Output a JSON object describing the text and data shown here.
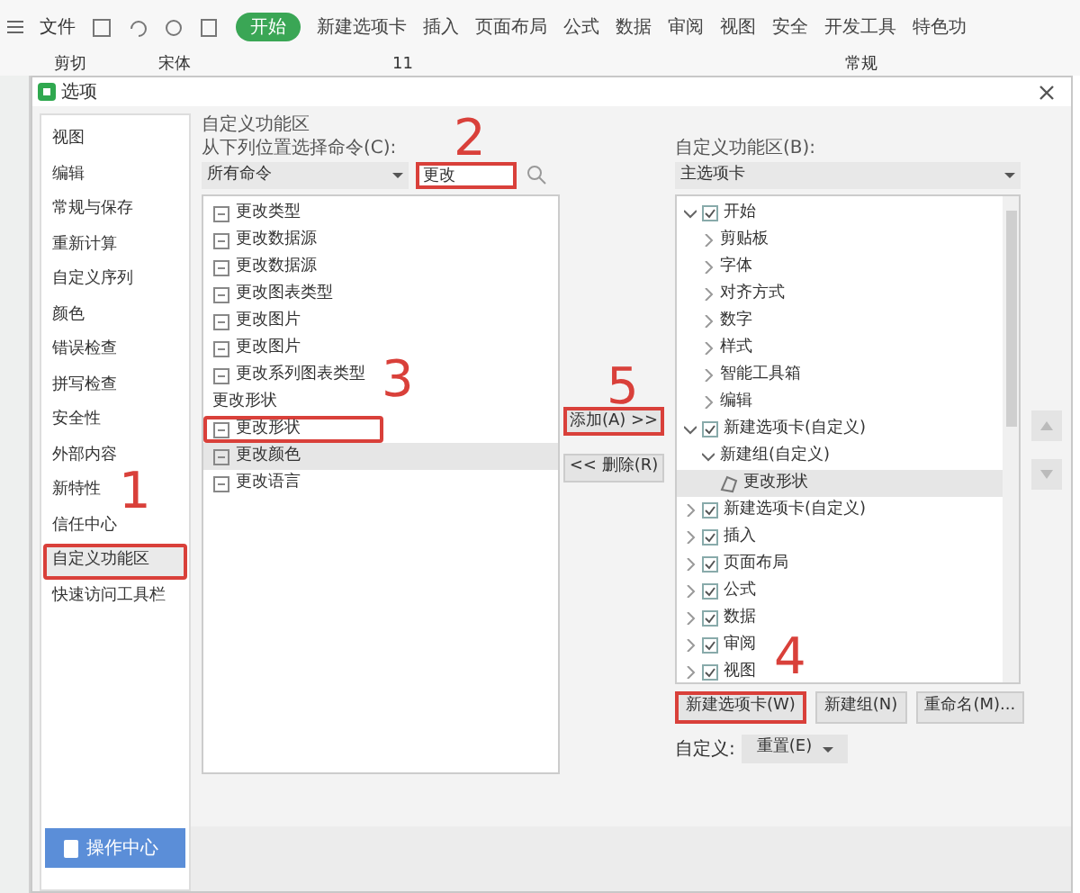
{
  "ribbon": {
    "file_menu": "文件",
    "tabs": [
      {
        "label": "开始",
        "selected": true
      },
      {
        "label": "新建选项卡",
        "selected": false
      },
      {
        "label": "插入",
        "selected": false
      },
      {
        "label": "页面布局",
        "selected": false
      },
      {
        "label": "公式",
        "selected": false
      },
      {
        "label": "数据",
        "selected": false
      },
      {
        "label": "审阅",
        "selected": false
      },
      {
        "label": "视图",
        "selected": false
      },
      {
        "label": "安全",
        "selected": false
      },
      {
        "label": "开发工具",
        "selected": false
      },
      {
        "label": "特色功",
        "selected": false
      }
    ]
  },
  "toolbar": {
    "cut": "剪切",
    "font": "宋体",
    "font_size": "11",
    "number_format": "常规"
  },
  "dialog": {
    "title": "选项",
    "sidebar": {
      "items": [
        {
          "label": "视图",
          "selected": false,
          "boxed": false
        },
        {
          "label": "编辑",
          "selected": false,
          "boxed": false
        },
        {
          "label": "常规与保存",
          "selected": false,
          "boxed": false
        },
        {
          "label": "重新计算",
          "selected": false,
          "boxed": false
        },
        {
          "label": "自定义序列",
          "selected": false,
          "boxed": false
        },
        {
          "label": "颜色",
          "selected": false,
          "boxed": false
        },
        {
          "label": "错误检查",
          "selected": false,
          "boxed": false
        },
        {
          "label": "拼写检查",
          "selected": false,
          "boxed": false
        },
        {
          "label": "安全性",
          "selected": false,
          "boxed": false
        },
        {
          "label": "外部内容",
          "selected": false,
          "boxed": false
        },
        {
          "label": "新特性",
          "selected": false,
          "boxed": false
        },
        {
          "label": "信任中心",
          "selected": false,
          "boxed": false
        },
        {
          "label": "自定义功能区",
          "selected": true,
          "boxed": true
        },
        {
          "label": "快速访问工具栏",
          "selected": false,
          "boxed": false
        }
      ],
      "action_button": "操作中心"
    },
    "left_panel": {
      "group_label": "自定义功能区",
      "source_label": "从下列位置选择命令(C):",
      "source_dropdown": "所有命令",
      "search": {
        "value": "更改",
        "boxed": true
      },
      "commands": [
        {
          "label": "更改类型",
          "kind": "command",
          "selected": false,
          "boxed": false
        },
        {
          "label": "更改数据源",
          "kind": "command",
          "selected": false,
          "boxed": false
        },
        {
          "label": "更改数据源",
          "kind": "command",
          "selected": false,
          "boxed": false
        },
        {
          "label": "更改图表类型",
          "kind": "command",
          "selected": false,
          "boxed": false
        },
        {
          "label": "更改图片",
          "kind": "command",
          "selected": false,
          "boxed": false
        },
        {
          "label": "更改图片",
          "kind": "command",
          "selected": false,
          "boxed": false
        },
        {
          "label": "更改系列图表类型",
          "kind": "command",
          "selected": false,
          "boxed": false
        },
        {
          "label": "更改形状",
          "kind": "heading",
          "selected": false,
          "boxed": false
        },
        {
          "label": "更改形状",
          "kind": "command",
          "selected": false,
          "boxed": true
        },
        {
          "label": "更改颜色",
          "kind": "command",
          "selected": true,
          "boxed": false
        },
        {
          "label": "更改语言",
          "kind": "command",
          "selected": false,
          "boxed": false
        }
      ]
    },
    "add_button": {
      "label": "添加(A) >>",
      "boxed": true
    },
    "remove_button": {
      "label": "<< 删除(R)",
      "boxed": false
    },
    "right_panel": {
      "label": "自定义功能区(B):",
      "dropdown": "主选项卡",
      "tree": [
        {
          "label": "开始",
          "kind": "tab",
          "checked": true,
          "expanded": true,
          "selected": false,
          "children": [
            {
              "label": "剪贴板",
              "kind": "group",
              "expanded": false,
              "selected": false
            },
            {
              "label": "字体",
              "kind": "group",
              "expanded": false,
              "selected": false
            },
            {
              "label": "对齐方式",
              "kind": "group",
              "expanded": false,
              "selected": false
            },
            {
              "label": "数字",
              "kind": "group",
              "expanded": false,
              "selected": false
            },
            {
              "label": "样式",
              "kind": "group",
              "expanded": false,
              "selected": false
            },
            {
              "label": "智能工具箱",
              "kind": "group",
              "expanded": false,
              "selected": false
            },
            {
              "label": "编辑",
              "kind": "group",
              "expanded": false,
              "selected": false
            }
          ]
        },
        {
          "label": "新建选项卡(自定义)",
          "kind": "tab",
          "checked": true,
          "expanded": true,
          "selected": false,
          "children": [
            {
              "label": "新建组(自定义)",
              "kind": "group",
              "expanded": true,
              "selected": false,
              "children": [
                {
                  "label": "更改形状",
                  "kind": "command",
                  "selected": true
                }
              ]
            }
          ]
        },
        {
          "label": "新建选项卡(自定义)",
          "kind": "tab",
          "checked": true,
          "expanded": false,
          "selected": false
        },
        {
          "label": "插入",
          "kind": "tab",
          "checked": true,
          "expanded": false,
          "selected": false
        },
        {
          "label": "页面布局",
          "kind": "tab",
          "checked": true,
          "expanded": false,
          "selected": false
        },
        {
          "label": "公式",
          "kind": "tab",
          "checked": true,
          "expanded": false,
          "selected": false
        },
        {
          "label": "数据",
          "kind": "tab",
          "checked": true,
          "expanded": false,
          "selected": false
        },
        {
          "label": "审阅",
          "kind": "tab",
          "checked": true,
          "expanded": false,
          "selected": false
        },
        {
          "label": "视图",
          "kind": "tab",
          "checked": true,
          "expanded": false,
          "selected": false
        }
      ],
      "buttons": [
        {
          "label": "新建选项卡(W)",
          "boxed": true
        },
        {
          "label": "新建组(N)",
          "boxed": false
        },
        {
          "label": "重命名(M)...",
          "boxed": false
        }
      ],
      "customize_label": "自定义:",
      "reset_dropdown": "重置(E)"
    }
  },
  "annotations": [
    {
      "text": "1"
    },
    {
      "text": "2"
    },
    {
      "text": "3"
    },
    {
      "text": "4"
    },
    {
      "text": "5"
    }
  ]
}
